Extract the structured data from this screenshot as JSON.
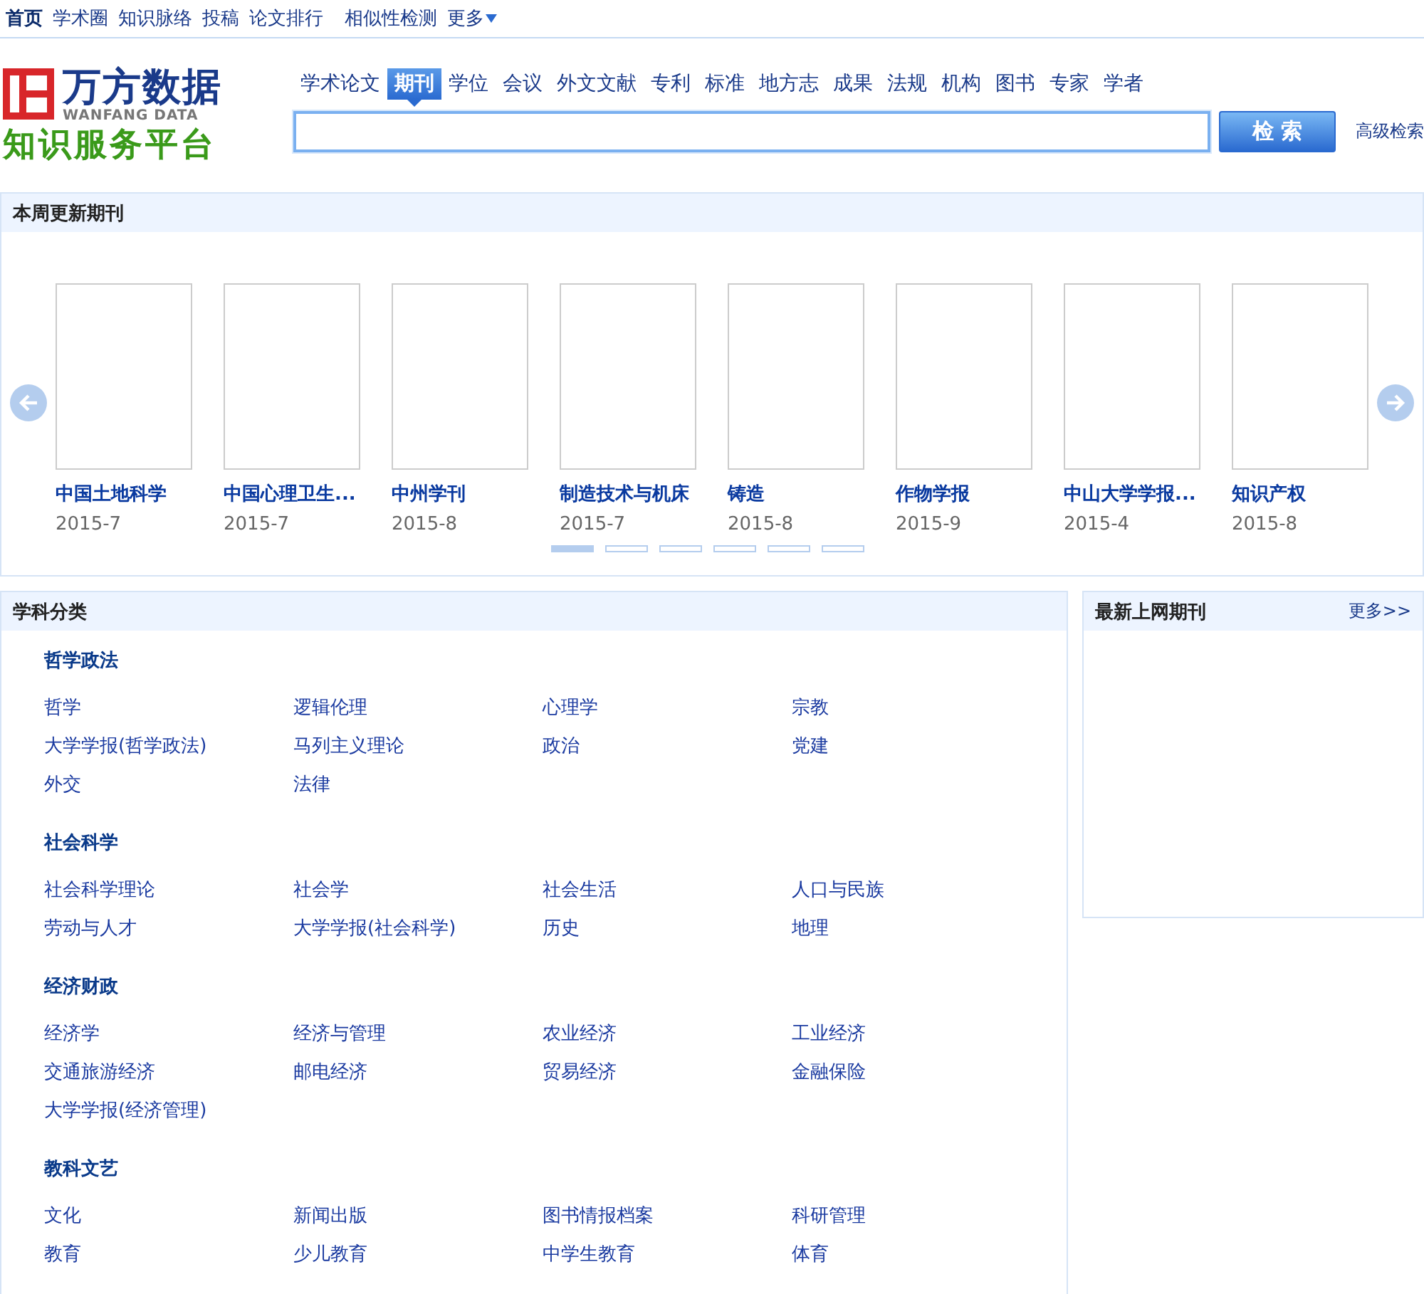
{
  "top_nav": [
    {
      "label": "首页",
      "selected": true
    },
    {
      "label": "学术圈",
      "selected": false
    },
    {
      "label": "知识脉络",
      "selected": false
    },
    {
      "label": "投稿",
      "selected": false
    },
    {
      "label": "论文排行",
      "selected": false
    },
    {
      "label": "相似性检测",
      "selected": false
    },
    {
      "label": "更多",
      "selected": false,
      "kind": "dropdown"
    }
  ],
  "logo": {
    "name": "万方数据",
    "subtitle": "WANFANG DATA",
    "slogan": "知识服务平台"
  },
  "search_tabs": [
    {
      "label": "学术论文",
      "selected": false
    },
    {
      "label": "期刊",
      "selected": true
    },
    {
      "label": "学位",
      "selected": false
    },
    {
      "label": "会议",
      "selected": false
    },
    {
      "label": "外文文献",
      "selected": false
    },
    {
      "label": "专利",
      "selected": false
    },
    {
      "label": "标准",
      "selected": false
    },
    {
      "label": "地方志",
      "selected": false
    },
    {
      "label": "成果",
      "selected": false
    },
    {
      "label": "法规",
      "selected": false
    },
    {
      "label": "机构",
      "selected": false
    },
    {
      "label": "图书",
      "selected": false
    },
    {
      "label": "专家",
      "selected": false
    },
    {
      "label": "学者",
      "selected": false
    }
  ],
  "search": {
    "button": "检 索",
    "advanced_link": "高级检索"
  },
  "weekly_journals": {
    "title": "本周更新期刊",
    "items": [
      {
        "title": "中国土地科学",
        "date": "2015-7"
      },
      {
        "title": "中国心理卫生...",
        "date": "2015-7"
      },
      {
        "title": "中州学刊",
        "date": "2015-8"
      },
      {
        "title": "制造技术与机床",
        "date": "2015-7"
      },
      {
        "title": "铸造",
        "date": "2015-8"
      },
      {
        "title": "作物学报",
        "date": "2015-9"
      },
      {
        "title": "中山大学学报...",
        "date": "2015-4"
      },
      {
        "title": "知识产权",
        "date": "2015-8"
      }
    ],
    "pages": [
      {
        "selected": true
      },
      {
        "selected": false
      },
      {
        "selected": false
      },
      {
        "selected": false
      },
      {
        "selected": false
      },
      {
        "selected": false
      }
    ]
  },
  "subjects": {
    "title": "学科分类",
    "groups": [
      {
        "title": "哲学政法",
        "items": [
          "哲学",
          "逻辑伦理",
          "心理学",
          "宗教",
          "大学学报(哲学政法)",
          "马列主义理论",
          "政治",
          "党建",
          "外交",
          "法律"
        ]
      },
      {
        "title": "社会科学",
        "items": [
          "社会科学理论",
          "社会学",
          "社会生活",
          "人口与民族",
          "劳动与人才",
          "大学学报(社会科学)",
          "历史",
          "地理"
        ]
      },
      {
        "title": "经济财政",
        "items": [
          "经济学",
          "经济与管理",
          "农业经济",
          "工业经济",
          "交通旅游经济",
          "邮电经济",
          "贸易经济",
          "金融保险",
          "大学学报(经济管理)"
        ]
      },
      {
        "title": "教科文艺",
        "items": [
          "文化",
          "新闻出版",
          "图书情报档案",
          "科研管理",
          "教育",
          "少儿教育",
          "中学生教育",
          "体育"
        ]
      }
    ]
  },
  "latest_journals": {
    "title": "最新上网期刊",
    "more": "更多>>"
  }
}
